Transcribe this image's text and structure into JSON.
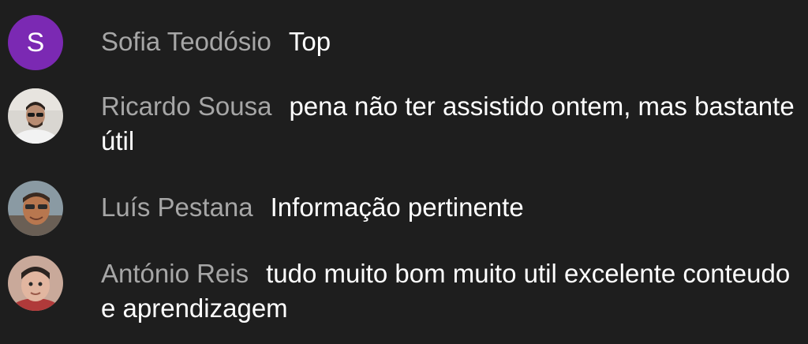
{
  "comments": [
    {
      "author": "Sofia Teodósio",
      "avatar_letter": "S",
      "message": "Top"
    },
    {
      "author": "Ricardo Sousa",
      "message": "pena não ter assistido ontem, mas bastante útil"
    },
    {
      "author": "Luís Pestana",
      "message": "Informação pertinente"
    },
    {
      "author": "António Reis",
      "message": "tudo muito bom muito util excelente conteudo e aprendizagem"
    }
  ]
}
